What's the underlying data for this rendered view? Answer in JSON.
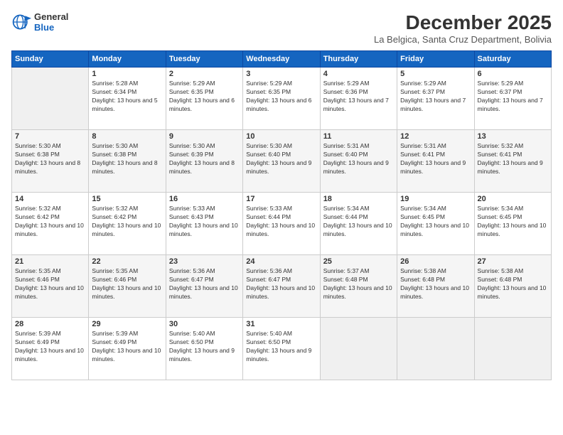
{
  "logo": {
    "line1": "General",
    "line2": "Blue"
  },
  "title": "December 2025",
  "location": "La Belgica, Santa Cruz Department, Bolivia",
  "days_header": [
    "Sunday",
    "Monday",
    "Tuesday",
    "Wednesday",
    "Thursday",
    "Friday",
    "Saturday"
  ],
  "weeks": [
    [
      {
        "num": "",
        "empty": true
      },
      {
        "num": "1",
        "sunrise": "Sunrise: 5:28 AM",
        "sunset": "Sunset: 6:34 PM",
        "daylight": "Daylight: 13 hours and 5 minutes."
      },
      {
        "num": "2",
        "sunrise": "Sunrise: 5:29 AM",
        "sunset": "Sunset: 6:35 PM",
        "daylight": "Daylight: 13 hours and 6 minutes."
      },
      {
        "num": "3",
        "sunrise": "Sunrise: 5:29 AM",
        "sunset": "Sunset: 6:35 PM",
        "daylight": "Daylight: 13 hours and 6 minutes."
      },
      {
        "num": "4",
        "sunrise": "Sunrise: 5:29 AM",
        "sunset": "Sunset: 6:36 PM",
        "daylight": "Daylight: 13 hours and 7 minutes."
      },
      {
        "num": "5",
        "sunrise": "Sunrise: 5:29 AM",
        "sunset": "Sunset: 6:37 PM",
        "daylight": "Daylight: 13 hours and 7 minutes."
      },
      {
        "num": "6",
        "sunrise": "Sunrise: 5:29 AM",
        "sunset": "Sunset: 6:37 PM",
        "daylight": "Daylight: 13 hours and 7 minutes."
      }
    ],
    [
      {
        "num": "7",
        "sunrise": "Sunrise: 5:30 AM",
        "sunset": "Sunset: 6:38 PM",
        "daylight": "Daylight: 13 hours and 8 minutes."
      },
      {
        "num": "8",
        "sunrise": "Sunrise: 5:30 AM",
        "sunset": "Sunset: 6:38 PM",
        "daylight": "Daylight: 13 hours and 8 minutes."
      },
      {
        "num": "9",
        "sunrise": "Sunrise: 5:30 AM",
        "sunset": "Sunset: 6:39 PM",
        "daylight": "Daylight: 13 hours and 8 minutes."
      },
      {
        "num": "10",
        "sunrise": "Sunrise: 5:30 AM",
        "sunset": "Sunset: 6:40 PM",
        "daylight": "Daylight: 13 hours and 9 minutes."
      },
      {
        "num": "11",
        "sunrise": "Sunrise: 5:31 AM",
        "sunset": "Sunset: 6:40 PM",
        "daylight": "Daylight: 13 hours and 9 minutes."
      },
      {
        "num": "12",
        "sunrise": "Sunrise: 5:31 AM",
        "sunset": "Sunset: 6:41 PM",
        "daylight": "Daylight: 13 hours and 9 minutes."
      },
      {
        "num": "13",
        "sunrise": "Sunrise: 5:32 AM",
        "sunset": "Sunset: 6:41 PM",
        "daylight": "Daylight: 13 hours and 9 minutes."
      }
    ],
    [
      {
        "num": "14",
        "sunrise": "Sunrise: 5:32 AM",
        "sunset": "Sunset: 6:42 PM",
        "daylight": "Daylight: 13 hours and 10 minutes."
      },
      {
        "num": "15",
        "sunrise": "Sunrise: 5:32 AM",
        "sunset": "Sunset: 6:42 PM",
        "daylight": "Daylight: 13 hours and 10 minutes."
      },
      {
        "num": "16",
        "sunrise": "Sunrise: 5:33 AM",
        "sunset": "Sunset: 6:43 PM",
        "daylight": "Daylight: 13 hours and 10 minutes."
      },
      {
        "num": "17",
        "sunrise": "Sunrise: 5:33 AM",
        "sunset": "Sunset: 6:44 PM",
        "daylight": "Daylight: 13 hours and 10 minutes."
      },
      {
        "num": "18",
        "sunrise": "Sunrise: 5:34 AM",
        "sunset": "Sunset: 6:44 PM",
        "daylight": "Daylight: 13 hours and 10 minutes."
      },
      {
        "num": "19",
        "sunrise": "Sunrise: 5:34 AM",
        "sunset": "Sunset: 6:45 PM",
        "daylight": "Daylight: 13 hours and 10 minutes."
      },
      {
        "num": "20",
        "sunrise": "Sunrise: 5:34 AM",
        "sunset": "Sunset: 6:45 PM",
        "daylight": "Daylight: 13 hours and 10 minutes."
      }
    ],
    [
      {
        "num": "21",
        "sunrise": "Sunrise: 5:35 AM",
        "sunset": "Sunset: 6:46 PM",
        "daylight": "Daylight: 13 hours and 10 minutes."
      },
      {
        "num": "22",
        "sunrise": "Sunrise: 5:35 AM",
        "sunset": "Sunset: 6:46 PM",
        "daylight": "Daylight: 13 hours and 10 minutes."
      },
      {
        "num": "23",
        "sunrise": "Sunrise: 5:36 AM",
        "sunset": "Sunset: 6:47 PM",
        "daylight": "Daylight: 13 hours and 10 minutes."
      },
      {
        "num": "24",
        "sunrise": "Sunrise: 5:36 AM",
        "sunset": "Sunset: 6:47 PM",
        "daylight": "Daylight: 13 hours and 10 minutes."
      },
      {
        "num": "25",
        "sunrise": "Sunrise: 5:37 AM",
        "sunset": "Sunset: 6:48 PM",
        "daylight": "Daylight: 13 hours and 10 minutes."
      },
      {
        "num": "26",
        "sunrise": "Sunrise: 5:38 AM",
        "sunset": "Sunset: 6:48 PM",
        "daylight": "Daylight: 13 hours and 10 minutes."
      },
      {
        "num": "27",
        "sunrise": "Sunrise: 5:38 AM",
        "sunset": "Sunset: 6:48 PM",
        "daylight": "Daylight: 13 hours and 10 minutes."
      }
    ],
    [
      {
        "num": "28",
        "sunrise": "Sunrise: 5:39 AM",
        "sunset": "Sunset: 6:49 PM",
        "daylight": "Daylight: 13 hours and 10 minutes."
      },
      {
        "num": "29",
        "sunrise": "Sunrise: 5:39 AM",
        "sunset": "Sunset: 6:49 PM",
        "daylight": "Daylight: 13 hours and 10 minutes."
      },
      {
        "num": "30",
        "sunrise": "Sunrise: 5:40 AM",
        "sunset": "Sunset: 6:50 PM",
        "daylight": "Daylight: 13 hours and 9 minutes."
      },
      {
        "num": "31",
        "sunrise": "Sunrise: 5:40 AM",
        "sunset": "Sunset: 6:50 PM",
        "daylight": "Daylight: 13 hours and 9 minutes."
      },
      {
        "num": "",
        "empty": true
      },
      {
        "num": "",
        "empty": true
      },
      {
        "num": "",
        "empty": true
      }
    ]
  ]
}
